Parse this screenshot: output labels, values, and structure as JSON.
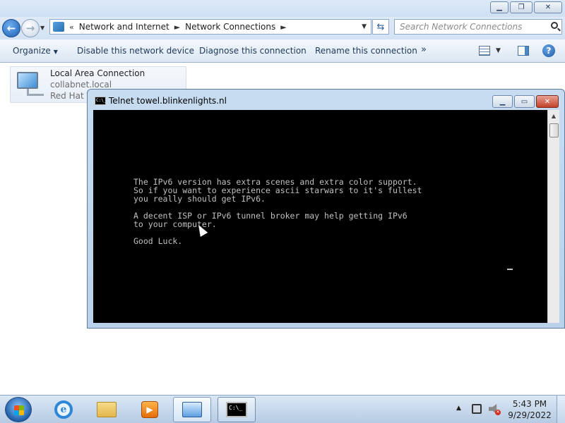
{
  "address": {
    "crumbs": [
      "Network and Internet",
      "Network Connections"
    ],
    "overflow": "«"
  },
  "search": {
    "placeholder": "Search Network Connections"
  },
  "toolbar": {
    "organize": "Organize",
    "disable": "Disable this network device",
    "diagnose": "Diagnose this connection",
    "rename": "Rename this connection",
    "more": "»"
  },
  "network_item": {
    "name": "Local Area Connection",
    "network": "collabnet.local",
    "adapter": "Red Hat V"
  },
  "console": {
    "title": "Telnet towel.blinkenlights.nl",
    "lines": [
      "The IPv6 version has extra scenes and extra color support.",
      "So if you want to experience ascii starwars to it's fullest",
      "you really should get IPv6.",
      "",
      "A decent ISP or IPv6 tunnel broker may help getting IPv6",
      "to your computer.",
      "",
      "Good Luck."
    ]
  },
  "taskbar": {
    "apps": [
      "internet-explorer",
      "windows-explorer",
      "windows-media-player",
      "control-panel",
      "command-prompt"
    ],
    "time": "5:43 PM",
    "date": "9/29/2022"
  }
}
